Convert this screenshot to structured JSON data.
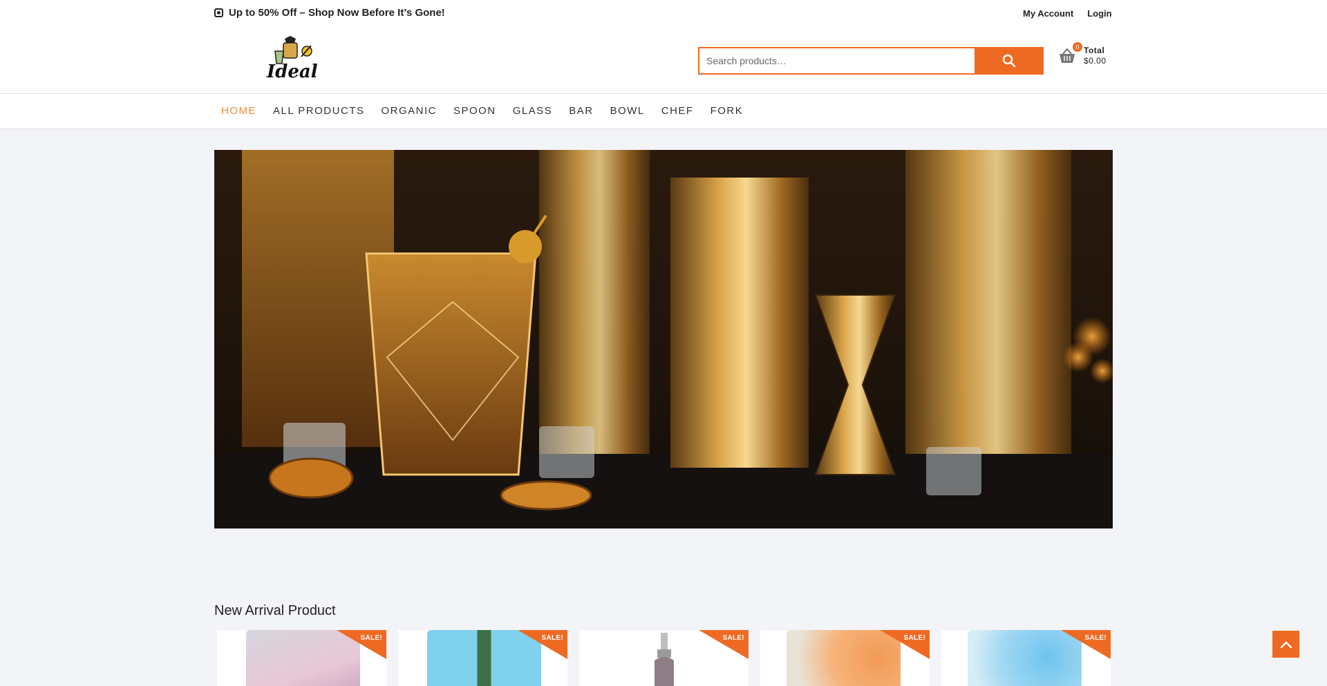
{
  "promo": {
    "text": "Up to 50% Off – Shop Now Before It’s Gone!",
    "icon": "skype-icon"
  },
  "account": {
    "my_account": "My Account",
    "login": "Login"
  },
  "search": {
    "placeholder": "Search products…"
  },
  "cart": {
    "count": "0",
    "total_label": "Total",
    "total_value": "$0.00"
  },
  "nav": {
    "items": [
      {
        "label": "HOME",
        "active": true
      },
      {
        "label": "ALL PRODUCTS"
      },
      {
        "label": "ORGANIC"
      },
      {
        "label": "SPOON"
      },
      {
        "label": "GLASS"
      },
      {
        "label": "BAR"
      },
      {
        "label": "BOWL"
      },
      {
        "label": "CHEF"
      },
      {
        "label": "FORK"
      }
    ]
  },
  "section": {
    "title": "New Arrival Product"
  },
  "products": [
    {
      "badge": "SALE!",
      "color": "#e8c7d6"
    },
    {
      "badge": "SALE!",
      "color": "#7fd1ee"
    },
    {
      "badge": "SALE!",
      "color": "#d9d9d9"
    },
    {
      "badge": "SALE!",
      "color": "#f6a76a"
    },
    {
      "badge": "SALE!",
      "color": "#9fd8f2"
    }
  ],
  "colors": {
    "accent": "#ee6a23",
    "nav_active": "#ee8a3a",
    "page_bg": "#f3f4f8"
  }
}
